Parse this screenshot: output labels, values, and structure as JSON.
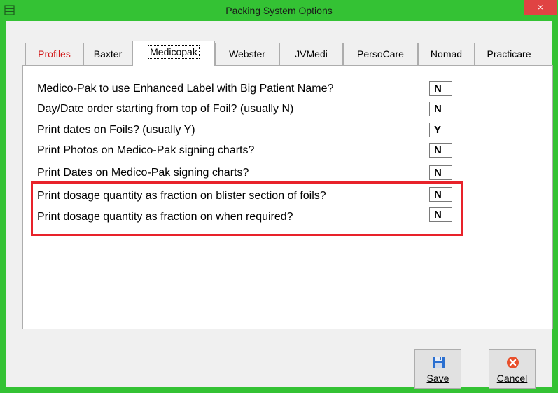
{
  "window": {
    "title": "Packing System Options",
    "close_glyph": "×"
  },
  "tabs": [
    {
      "label": "Profiles",
      "active": false
    },
    {
      "label": "Baxter",
      "active": false
    },
    {
      "label": "Medicopak",
      "active": true
    },
    {
      "label": "Webster",
      "active": false
    },
    {
      "label": "JVMedi",
      "active": false
    },
    {
      "label": "PersoCare",
      "active": false
    },
    {
      "label": "Nomad",
      "active": false
    },
    {
      "label": "Practicare",
      "active": false
    }
  ],
  "options": [
    {
      "label": "Medico-Pak to use Enhanced Label with Big Patient Name?",
      "value": "N"
    },
    {
      "label": "Day/Date order starting from top of Foil? (usually N)",
      "value": "N"
    },
    {
      "label": "Print dates on Foils? (usually Y)",
      "value": "Y"
    },
    {
      "label": "Print Photos on Medico-Pak signing charts?",
      "value": "N"
    },
    {
      "label": "Print Dates on Medico-Pak signing charts?",
      "value": "N"
    },
    {
      "label": "Print dosage quantity as fraction on blister section of foils?",
      "value": "N"
    },
    {
      "label": "Print dosage quantity as fraction on when required?",
      "value": "N"
    }
  ],
  "buttons": {
    "save": {
      "label": "Save",
      "icon": "save-icon"
    },
    "cancel": {
      "label": "Cancel",
      "icon": "cancel-icon"
    }
  },
  "colors": {
    "titlebar": "#34c234",
    "close": "#e04343",
    "highlight": "#e8222a",
    "profiles_tab_text": "#d21a1a"
  }
}
